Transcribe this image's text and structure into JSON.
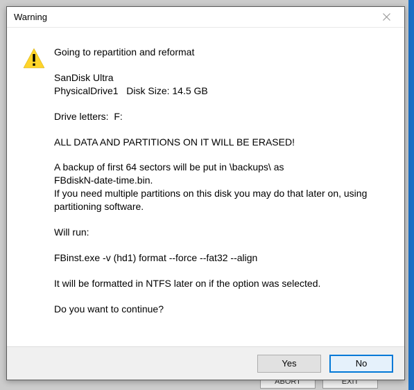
{
  "dialog": {
    "title": "Warning",
    "heading": "Going to repartition and reformat",
    "disk_name": "SanDisk Ultra",
    "physical_drive_label": "PhysicalDrive1",
    "disk_size_label": "Disk Size: 14.5 GB",
    "drive_letters_label": "Drive letters:",
    "drive_letters_value": "F:",
    "erase_warning": "ALL DATA AND PARTITIONS ON IT WILL BE ERASED!",
    "backup_line1": "A backup of first 64 sectors will be put in \\backups\\ as",
    "backup_line2": "FBdiskN-date-time.bin.",
    "backup_line3": "If you need multiple partitions on this disk you may do that later on, using partitioning software.",
    "will_run_label": "Will run:",
    "command": "FBinst.exe -v (hd1) format --force  --fat32 --align",
    "ntfs_note": "It will be formatted in NTFS later on if the option was selected.",
    "confirm_question": "Do you want to continue?",
    "buttons": {
      "yes": "Yes",
      "no": "No"
    }
  },
  "backdrop": {
    "abort": "ABORT",
    "exit": "EXIT"
  }
}
